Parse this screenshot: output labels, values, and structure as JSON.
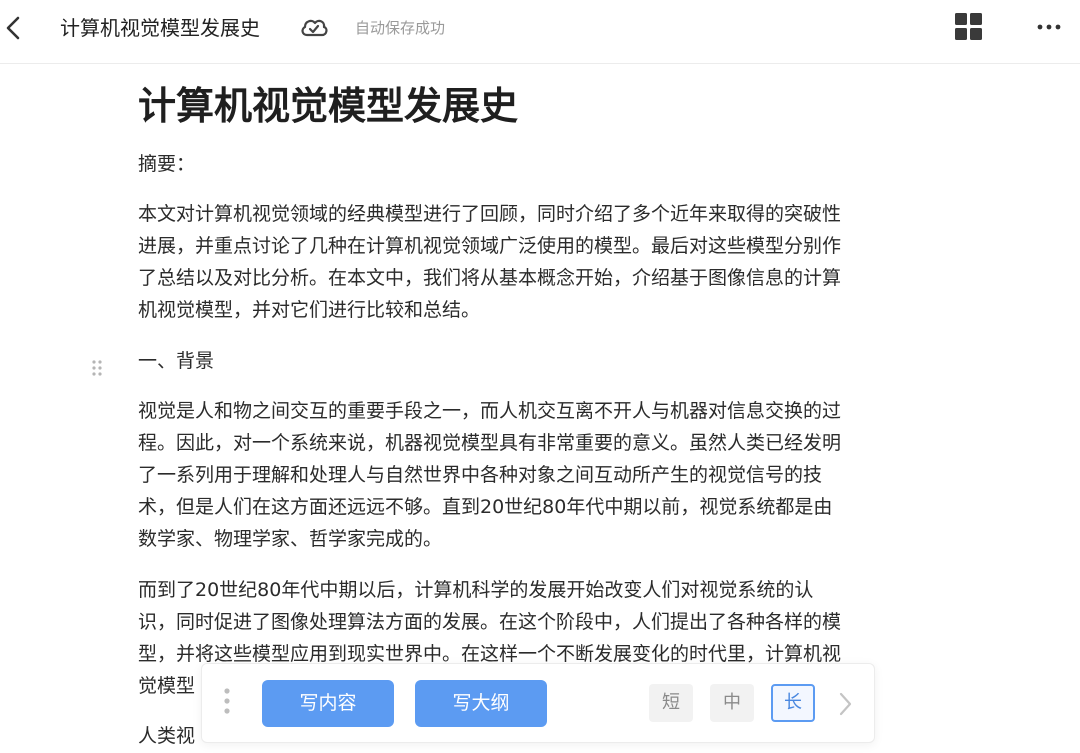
{
  "header": {
    "doc_title": "计算机视觉模型发展史",
    "save_status": "自动保存成功",
    "icons": [
      "back-arrow-icon",
      "cloud-sync-icon",
      "grid-view-icon",
      "more-icon"
    ]
  },
  "document": {
    "title": "计算机视觉模型发展史",
    "abstract_label": "摘要：",
    "abstract_lines": [
      "本文对计算机视觉领域的经典模型进行了回顾，同时介绍了多个近年来取得的突破性",
      "进展，并重点讨论了几种在计算机视觉领域广泛使用的模型。最后对这些模型分别作",
      "了总结以及对比分析。在本文中，我们将从基本概念开始，介绍基于图像信息的计算",
      "机视觉模型，并对它们进行比较和总结。"
    ],
    "section_heading": "一、背景",
    "para1_lines": [
      "视觉是人和物之间交互的重要手段之一，而人机交互离不开人与机器对信息交换的过",
      "程。因此，对一个系统来说，机器视觉模型具有非常重要的意义。虽然人类已经发明",
      "了一系列用于理解和处理人与自然世界中各种对象之间互动所产生的视觉信号的技",
      "术，但是人们在这方面还远远不够。直到20世纪80年代中期以前，视觉系统都是由",
      "数学家、物理学家、哲学家完成的。"
    ],
    "para2_lines": [
      "而到了20世纪80年代中期以后，计算机科学的发展开始改变人们对视觉系统的认",
      "识，同时促进了图像处理算法方面的发展。在这个阶段中，人们提出了各种各样的模",
      "型，并将这些模型应用到现实世界中。在这样一个不断发展变化的时代里，计算机视",
      "觉模型"
    ],
    "para3_partial": "人类视"
  },
  "ai_toolbar": {
    "write_content": "写内容",
    "write_outline": "写大纲",
    "length_options": [
      "短",
      "中",
      "长"
    ],
    "selected_length": "长",
    "accent_color": "#5c9bf2"
  }
}
